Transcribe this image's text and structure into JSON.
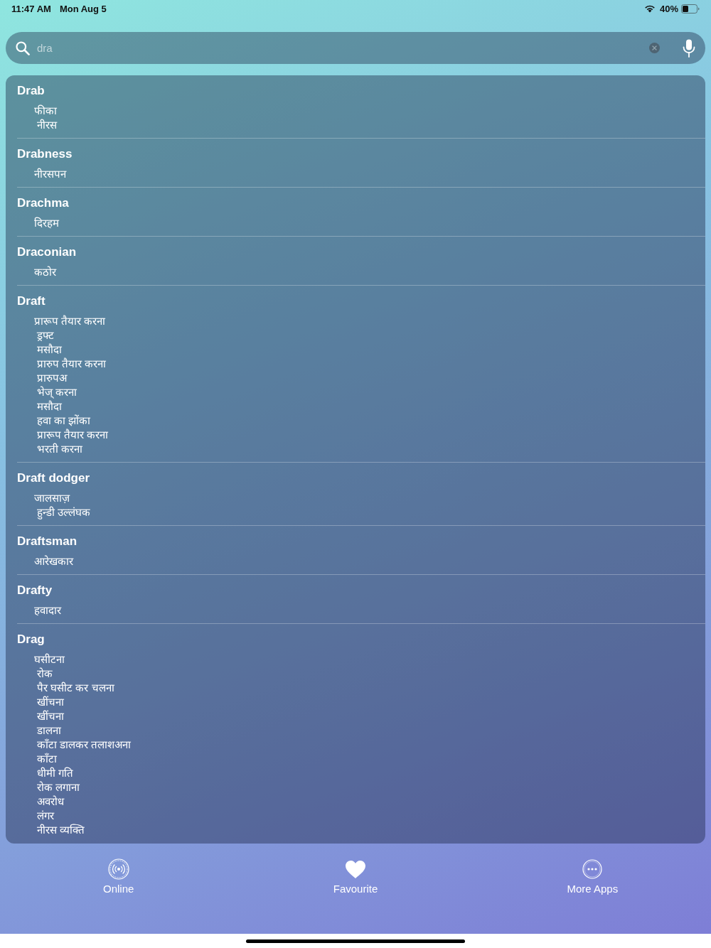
{
  "status_bar": {
    "time": "11:47 AM",
    "date": "Mon Aug 5",
    "battery": "40%"
  },
  "search": {
    "value": "dra"
  },
  "entries": [
    {
      "word": "Drab",
      "meanings": [
        "फीका",
        "नीरस"
      ]
    },
    {
      "word": "Drabness",
      "meanings": [
        "नीरसपन"
      ]
    },
    {
      "word": "Drachma",
      "meanings": [
        "दिरहम"
      ]
    },
    {
      "word": "Draconian",
      "meanings": [
        "कठोर"
      ]
    },
    {
      "word": "Draft",
      "meanings": [
        "प्रारूप तैयार करना",
        "ड्रफ्ट",
        "मसौदा",
        "प्रारुप तैयार करना",
        "प्रारुपअ",
        "भेज् करना",
        "मसौदा",
        "हवा का झोंका",
        "प्रारूप तैयार करना",
        "भरती करना"
      ]
    },
    {
      "word": "Draft dodger",
      "meanings": [
        "जालसाज़",
        "हुन्डी उल्लंघक"
      ]
    },
    {
      "word": "Draftsman",
      "meanings": [
        "आरेखकार"
      ]
    },
    {
      "word": "Drafty",
      "meanings": [
        "हवादार"
      ]
    },
    {
      "word": "Drag",
      "meanings": [
        "घसीटना",
        "रोक",
        "पैर घसीट कर चलना",
        "खींचना",
        "खींचना",
        "डालना",
        "काँटा डालकर तलाशअना",
        "काँटा",
        "धीमी गति",
        "रोक लगाना",
        "अवरोध",
        "लंगर",
        "नीरस व्यक्ति"
      ]
    }
  ],
  "tab_bar": {
    "items": [
      {
        "label": "Online",
        "kind": "online"
      },
      {
        "label": "Favourite",
        "kind": "favourite"
      },
      {
        "label": "More Apps",
        "kind": "more"
      }
    ]
  }
}
